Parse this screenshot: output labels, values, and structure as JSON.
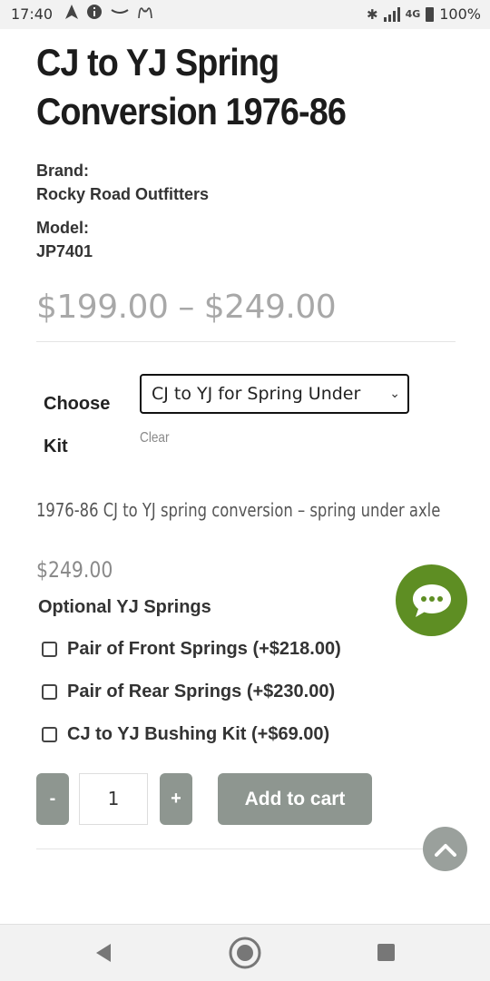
{
  "status_bar": {
    "time": "17:40",
    "left_icons": [
      "navigation-icon",
      "info-icon",
      "amazon-icon",
      "mcdonalds-icon"
    ],
    "right_icons": [
      "bluetooth-icon",
      "signal-icon",
      "network-4g-icon",
      "battery-icon"
    ],
    "network": "4G",
    "battery": "100%"
  },
  "product": {
    "title": "CJ to YJ Spring Conversion 1976-86",
    "brand_label": "Brand:",
    "brand": "Rocky Road Outfitters",
    "model_label": "Model:",
    "model": "JP7401",
    "price_range": "$199.00 – $249.00"
  },
  "variation": {
    "label": "Choose Kit",
    "selected": "CJ to YJ for Spring Under",
    "clear": "Clear",
    "description": "1976-86 CJ to YJ spring conversion – spring under axle",
    "price": "$249.00"
  },
  "options": {
    "heading": "Optional YJ Springs",
    "items": [
      {
        "label": "Pair of Front Springs (+$218.00)",
        "checked": false
      },
      {
        "label": "Pair of Rear Springs (+$230.00)",
        "checked": false
      },
      {
        "label": "CJ to YJ Bushing Kit (+$69.00)",
        "checked": false
      }
    ]
  },
  "cart": {
    "minus": "-",
    "quantity": "1",
    "plus": "+",
    "add_to_cart": "Add to cart"
  },
  "colors": {
    "chat_button": "#5e8e23",
    "button_gray": "#8e9690",
    "price_gray": "#a8a8a8"
  }
}
